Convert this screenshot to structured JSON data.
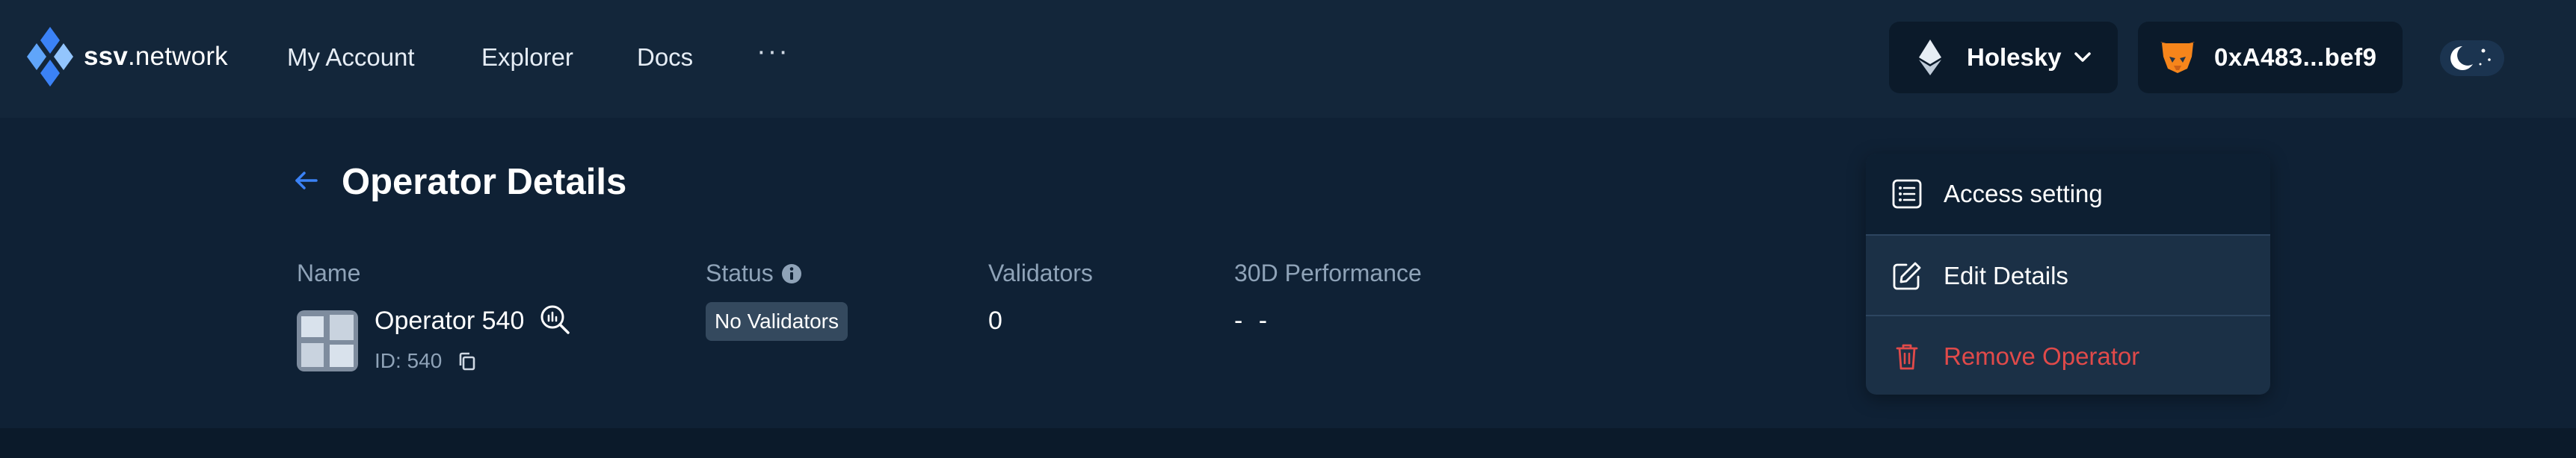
{
  "header": {
    "logo_brand": "ssv",
    "logo_suffix": ".network",
    "nav": {
      "my_account": "My Account",
      "explorer": "Explorer",
      "docs": "Docs",
      "more": "···"
    },
    "network": "Holesky",
    "wallet": "0xA483...bef9"
  },
  "page": {
    "title": "Operator Details"
  },
  "operator": {
    "columns": {
      "name": "Name",
      "status": "Status",
      "validators": "Validators",
      "performance": "30D Performance"
    },
    "name": "Operator 540",
    "id_text": "ID: 540",
    "status": "No Validators",
    "validators": "0",
    "performance": "- -"
  },
  "menu": {
    "items": [
      {
        "label": "Access setting",
        "icon": "list-icon"
      },
      {
        "label": "Edit Details",
        "icon": "edit-icon"
      },
      {
        "label": "Remove Operator",
        "icon": "trash-icon"
      }
    ]
  },
  "colors": {
    "header_bg": "#13263a",
    "content_bg": "#0f2135",
    "accent_blue": "#3b82f6",
    "danger_red": "#e04a4a",
    "muted_text": "#8fa3b8"
  }
}
